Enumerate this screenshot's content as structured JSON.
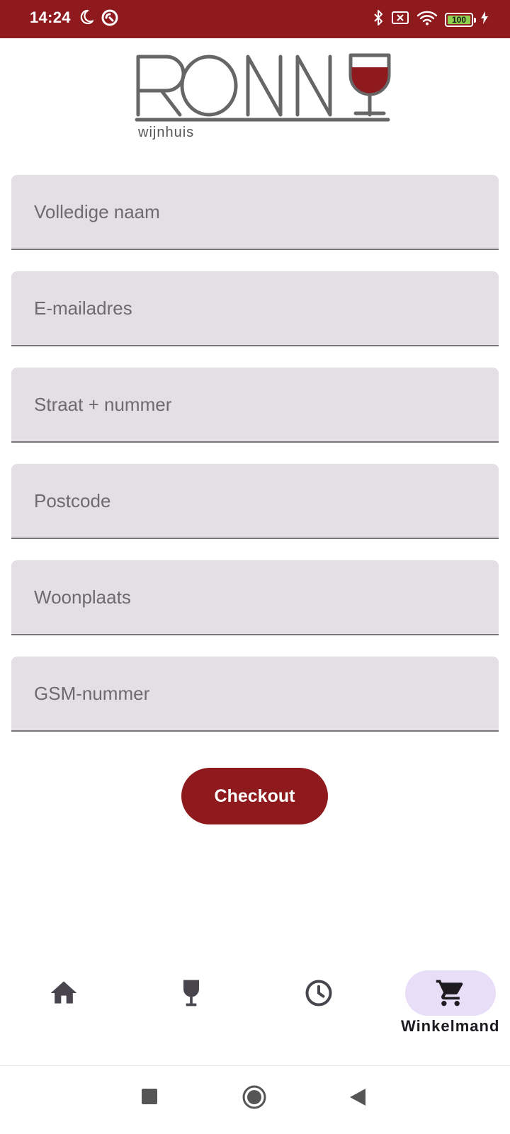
{
  "status_bar": {
    "time": "14:24",
    "battery_level": "100"
  },
  "brand": {
    "logo_text": "RONNY",
    "logo_subtitle": "wijnhuis",
    "accent_color": "#8e1a1d"
  },
  "form": {
    "fields": [
      {
        "placeholder": "Volledige naam",
        "value": ""
      },
      {
        "placeholder": "E-mailadres",
        "value": ""
      },
      {
        "placeholder": "Straat + nummer",
        "value": ""
      },
      {
        "placeholder": "Postcode",
        "value": ""
      },
      {
        "placeholder": "Woonplaats",
        "value": ""
      },
      {
        "placeholder": "GSM-nummer",
        "value": ""
      }
    ],
    "checkout_label": "Checkout"
  },
  "bottom_nav": {
    "items": [
      {
        "icon": "home-icon",
        "label": ""
      },
      {
        "icon": "wine-glass-icon",
        "label": ""
      },
      {
        "icon": "clock-icon",
        "label": ""
      },
      {
        "icon": "cart-icon",
        "label": "Winkelmand",
        "active": true
      }
    ]
  }
}
